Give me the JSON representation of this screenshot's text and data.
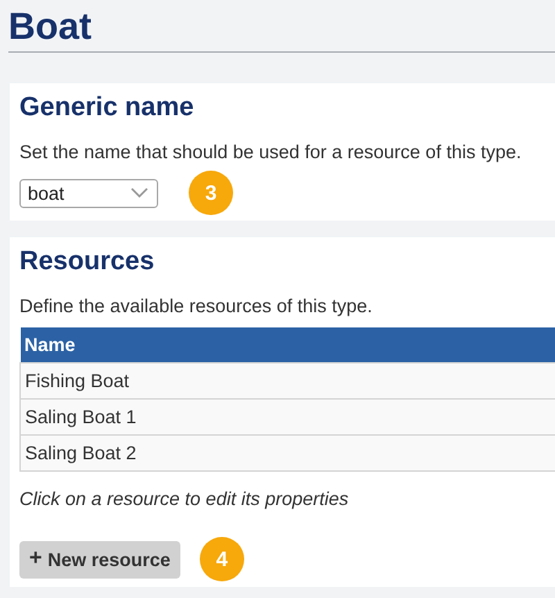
{
  "title": "Boat",
  "generic_name": {
    "heading": "Generic name",
    "description": "Set the name that should be used for a resource of this type.",
    "select_value": "boat",
    "step_badge": "3"
  },
  "resources": {
    "heading": "Resources",
    "description": "Define the available resources of this type.",
    "table": {
      "columns": [
        "Name"
      ],
      "rows": [
        [
          "Fishing Boat"
        ],
        [
          "Saling Boat 1"
        ],
        [
          "Saling Boat 2"
        ]
      ]
    },
    "hint": "Click on a resource to edit its properties",
    "new_button": {
      "icon": "+",
      "label": "New resource"
    },
    "step_badge": "4"
  }
}
